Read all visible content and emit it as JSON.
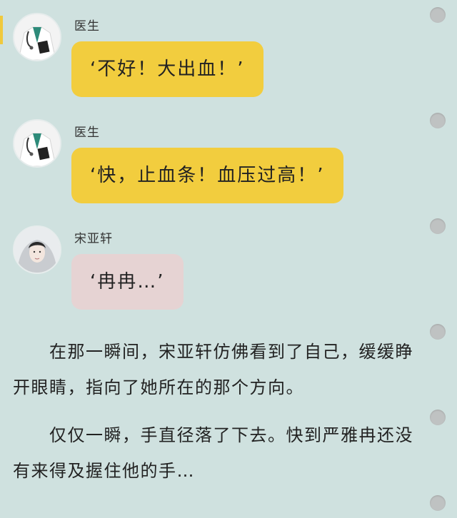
{
  "messages": [
    {
      "sender": "医生",
      "text": "‘不好！大出血！’",
      "bubble_color": "#f2cd3e",
      "avatar": "doctor-avatar"
    },
    {
      "sender": "医生",
      "text": "‘快，止血条！血压过高！’",
      "bubble_color": "#f2cd3e",
      "avatar": "doctor-avatar"
    },
    {
      "sender": "宋亚轩",
      "text": "‘冉冉…’",
      "bubble_color": "#e6d3d3",
      "avatar": "person-avatar"
    }
  ],
  "narration": {
    "paragraph1": "　　在那一瞬间，宋亚轩仿佛看到了自己，缓缓睁开眼睛，指向了她所在的那个方向。",
    "paragraph2": "　　仅仅一瞬，手直径落了下去。快到严雅冉还没有来得及握住他的手…"
  },
  "colors": {
    "background": "#cfe1df",
    "yellow_bubble": "#f2cd3e",
    "pink_bubble": "#e6d3d3",
    "hole": "#bfc2c2"
  }
}
